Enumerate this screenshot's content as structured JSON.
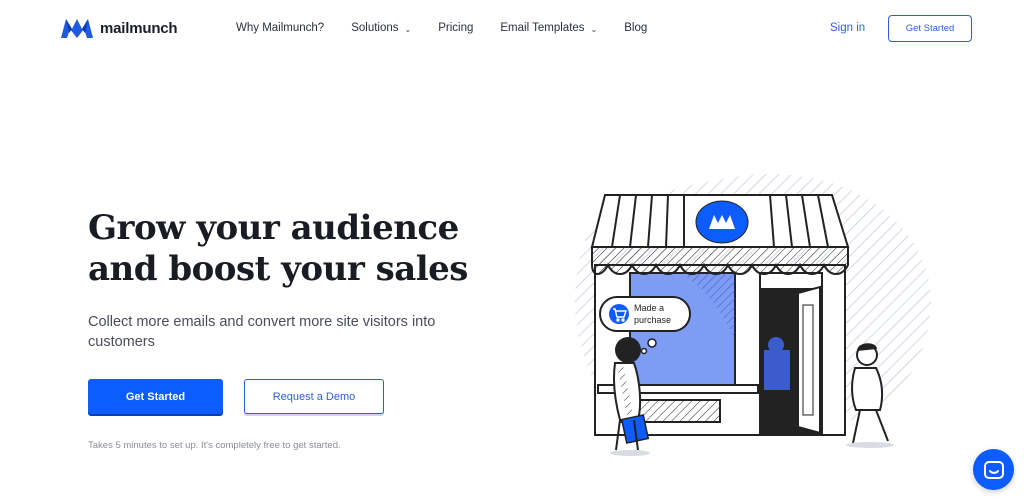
{
  "brand": {
    "name": "mailmunch"
  },
  "nav": {
    "items": [
      {
        "label": "Why Mailmunch?",
        "dropdown": false
      },
      {
        "label": "Solutions",
        "dropdown": true
      },
      {
        "label": "Pricing",
        "dropdown": false
      },
      {
        "label": "Email Templates",
        "dropdown": true
      },
      {
        "label": "Blog",
        "dropdown": false
      }
    ],
    "signin": "Sign in",
    "cta": "Get Started"
  },
  "hero": {
    "headline_line1": "Grow your audience",
    "headline_line2": "and boost your sales",
    "subtitle": "Collect more emails and convert more site visitors into customers",
    "primary_cta": "Get Started",
    "secondary_cta": "Request a Demo",
    "note": "Takes 5 minutes to set up. It's completely free to get started."
  },
  "illustration": {
    "bubble_line1": "Made a",
    "bubble_line2": "purchase"
  },
  "colors": {
    "accent": "#0d5cff",
    "link": "#2d5fdc",
    "light_blue": "#7f9cf5"
  },
  "icons": [
    "mailmunch-logo-icon",
    "chevron-down-icon",
    "cart-icon",
    "chat-icon"
  ]
}
